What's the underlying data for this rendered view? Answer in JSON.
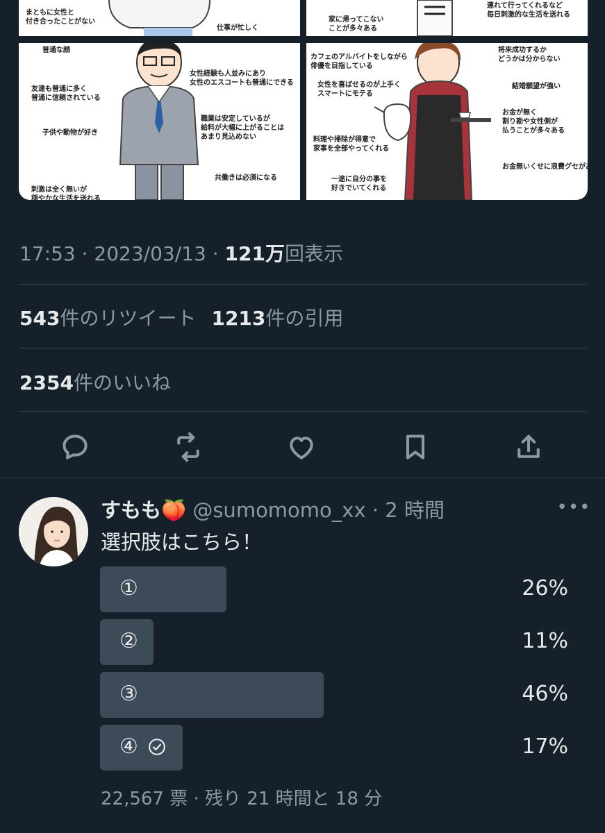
{
  "media": {
    "top_left": {
      "lines_right": [
        "まともに女性と",
        "付き合ったことがない"
      ],
      "lines_bottom": [
        "仕事が忙しく"
      ]
    },
    "top_right": {
      "lines_left": [
        "家に帰ってこない",
        "ことが多々ある"
      ],
      "lines_right": [
        "連れて行ってくれるなど",
        "毎日刺激的な生活を送れる"
      ]
    },
    "bottom_left": {
      "captions": [
        "普通な顔",
        "女性経験も人並みにあり\n女性のエスコートも普通にできる",
        "友達も普通に多く\n普通に信頼されている",
        "職業は安定しているが\n給料が大幅に上がることは\nあまり見込めない",
        "子供や動物が好き",
        "共働きは必須になる",
        "刺激は全く無いが\n穏やかな生活を送れる"
      ]
    },
    "bottom_right": {
      "captions": [
        "カフェのアルバイトをしながら\n俳優を目指している",
        "将来成功するか\nどうかは分からない",
        "女性を喜ばせるのが上手く\nスマートにモテる",
        "結婚願望が強い",
        "お金が無く\n割り勘や女性側が\n払うことが多々ある",
        "料理や掃除が得意で\n家事を全部やってくれる",
        "お金無いくせに浪費グセがある",
        "一途に自分の事を\n好きでいてくれる"
      ]
    }
  },
  "tweet": {
    "time": "17:53",
    "sep": "·",
    "date": "2023/03/13",
    "views_count": "121万",
    "views_label": "回表示",
    "retweets_count": "543",
    "retweets_label": "件のリツイート",
    "quotes_count": "1213",
    "quotes_label": "件の引用",
    "likes_count": "2354",
    "likes_label": "件のいいね"
  },
  "actions": [
    "reply-icon",
    "retweet-icon",
    "like-icon",
    "bookmark-icon",
    "share-icon"
  ],
  "reply": {
    "name": "すもも🍑",
    "handle": "@sumomomo_xx",
    "time": "· 2 時間",
    "more": "•••",
    "text": "選択肢はこちら！",
    "poll": [
      {
        "label": "①",
        "percent": "26%",
        "fraction": 0.26,
        "selected": false
      },
      {
        "label": "②",
        "percent": "11%",
        "fraction": 0.11,
        "selected": false
      },
      {
        "label": "③",
        "percent": "46%",
        "fraction": 0.46,
        "selected": false
      },
      {
        "label": "④",
        "percent": "17%",
        "fraction": 0.17,
        "selected": true
      }
    ],
    "footer": "22,567 票 · 残り 21 時間と 18 分"
  },
  "colors": {
    "background": "#15202b",
    "text_primary": "#e7e9ea",
    "text_secondary": "#8b98a5",
    "divider": "#38444d",
    "poll_bar": "#3d4a58"
  }
}
